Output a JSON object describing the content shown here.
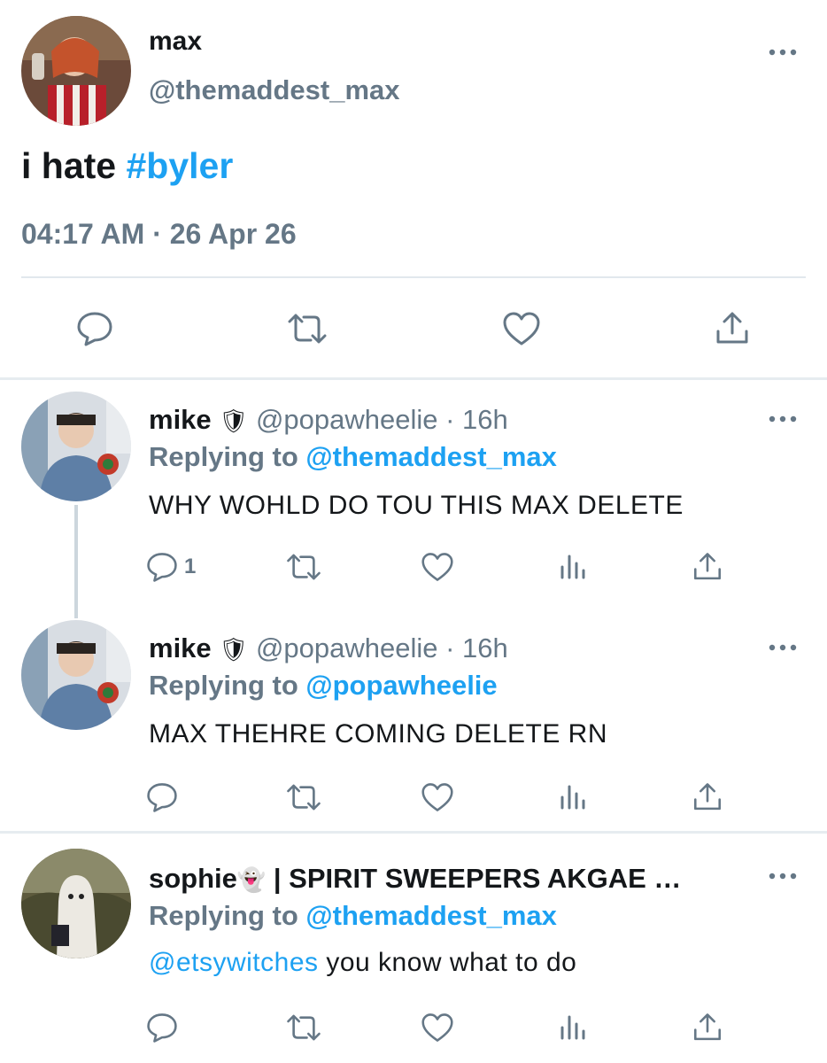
{
  "main_tweet": {
    "name": "max",
    "handle": "@themaddest_max",
    "text_plain": "i hate ",
    "hashtag": "#byler",
    "meta": "04:17 AM · 26 Apr 26",
    "avatar_icon": "profile-photo"
  },
  "replies": [
    {
      "name": "mike",
      "badge_emoji": "🛡",
      "handle_time": "@popawheelie · 16h",
      "replying_label": "Replying to ",
      "replying_to": "@themaddest_max",
      "text": "WHY WOHLD DO TOU THIS MAX DELETE",
      "reply_count": "1"
    },
    {
      "name": "mike",
      "badge_emoji": "🛡",
      "handle_time": "@popawheelie · 16h",
      "replying_label": "Replying to ",
      "replying_to": "@popawheelie",
      "text": "MAX THEHRE COMING DELETE RN"
    },
    {
      "name": "sophie",
      "badge_emoji": "👻",
      "display_suffix": " | SPIRIT SWEEPERS AKGAE …",
      "replying_label": "Replying to ",
      "replying_to": "@themaddest_max",
      "text_mention": "@etsywitches",
      "text_rest": " you know what to do"
    }
  ],
  "colors": {
    "accent": "#1da1f2",
    "secondary_text": "#657786",
    "primary_text": "#14171a",
    "divider": "#e6ecf0"
  },
  "icons": [
    "reply-icon",
    "retweet-icon",
    "like-icon",
    "share-icon",
    "analytics-icon",
    "more-icon"
  ]
}
